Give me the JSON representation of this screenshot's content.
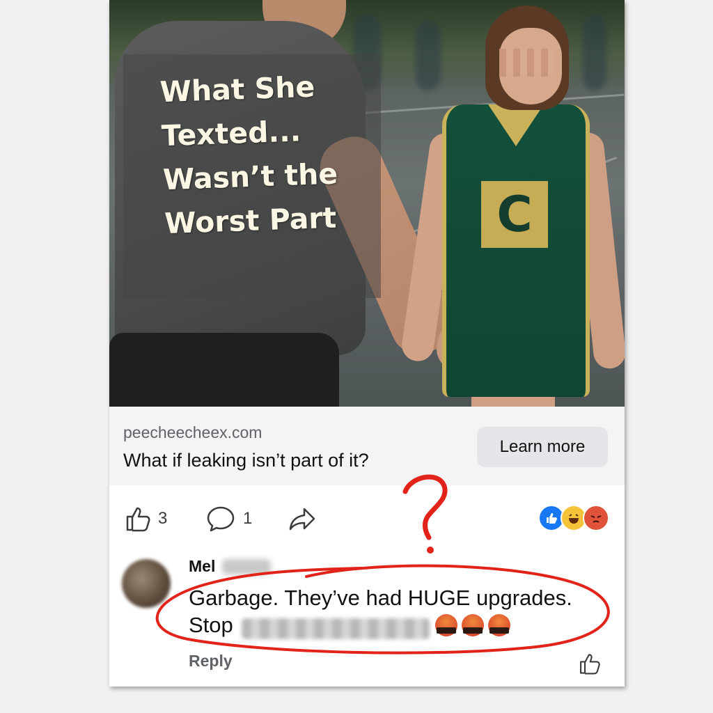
{
  "ad": {
    "image_text": [
      "What She",
      "Texted...",
      "Wasn’t the",
      "Worst Part"
    ],
    "bib_letter": "C",
    "domain": "peecheecheex.com",
    "headline": "What if leaking isn’t part of it?",
    "cta_label": "Learn more"
  },
  "actions": {
    "like_count": "3",
    "comment_count": "1",
    "reactions": [
      "like-reaction-icon",
      "haha-reaction-icon",
      "angry-reaction-icon"
    ]
  },
  "comment": {
    "author": "Mel",
    "line1": "Garbage. They’ve had HUGE upgrades.",
    "line2_prefix": "Stop",
    "reply_label": "Reply",
    "emoji": [
      "cursing-face-icon",
      "cursing-face-icon",
      "cursing-face-icon"
    ]
  },
  "annotation": {
    "mark": "?",
    "color": "#e2231a"
  },
  "colors": {
    "like_blue": "#1877f2",
    "angry_red": "#e0523a",
    "button_bg": "#e4e6e9"
  }
}
